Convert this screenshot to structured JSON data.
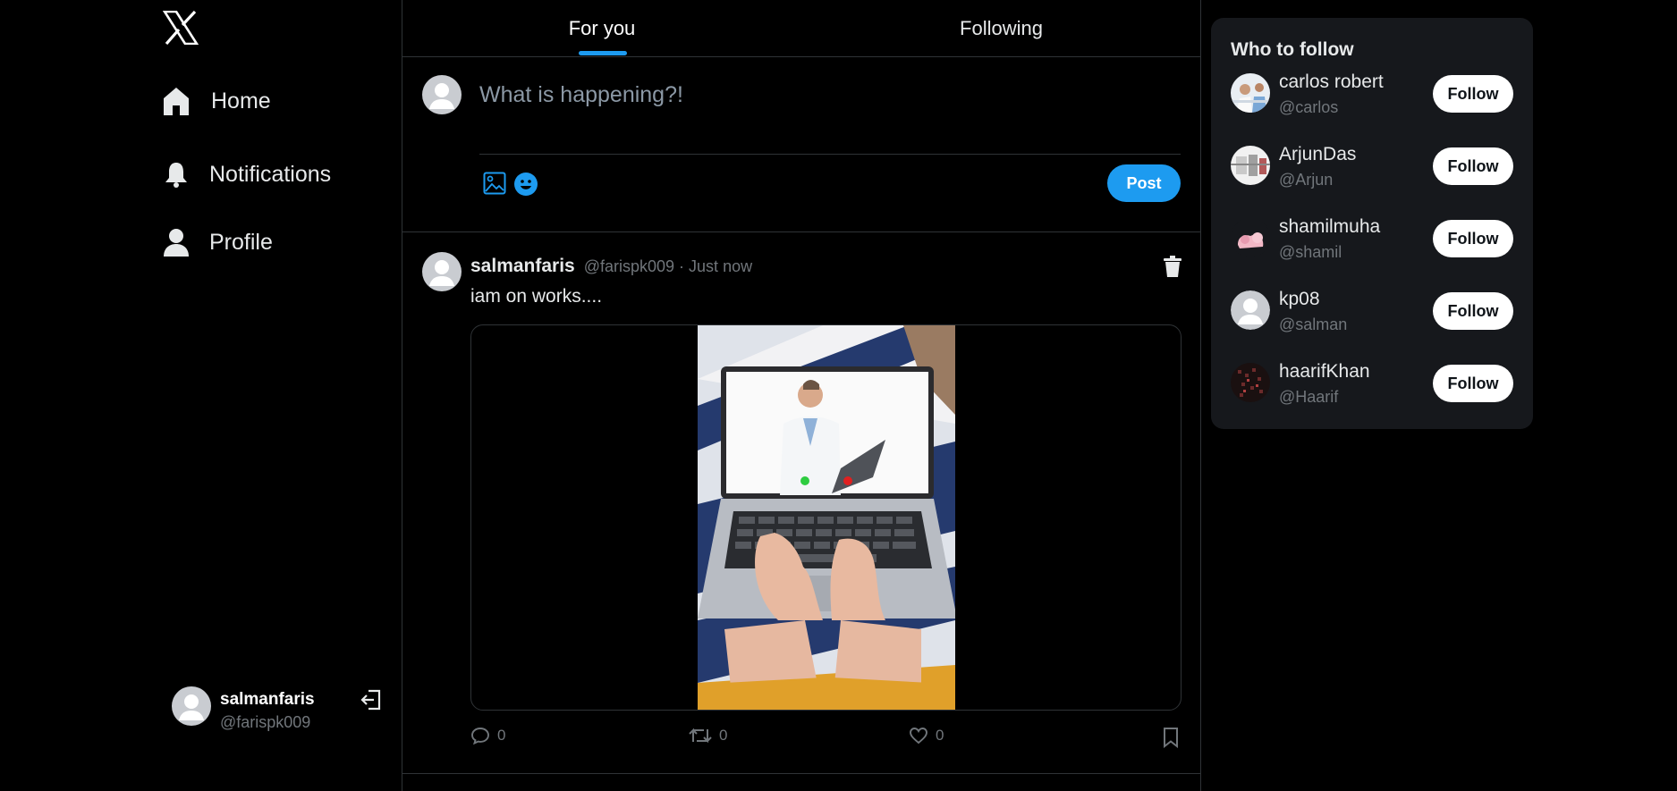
{
  "sidebar": {
    "logo": "x-logo",
    "items": [
      {
        "label": "Home",
        "icon": "home-icon"
      },
      {
        "label": "Notifications",
        "icon": "bell-icon"
      },
      {
        "label": "Profile",
        "icon": "person-icon"
      }
    ],
    "account": {
      "name": "salmanfaris",
      "handle": "@farispk009",
      "logout_icon": "logout-icon"
    }
  },
  "tabs": [
    {
      "label": "For you",
      "active": true
    },
    {
      "label": "Following",
      "active": false
    }
  ],
  "composer": {
    "placeholder": "What is happening?!",
    "post_label": "Post"
  },
  "tweet": {
    "author": "salmanfaris",
    "handle": "@farispk009 · Just now",
    "text": "iam on works....",
    "reply_count": "0",
    "retweet_count": "0",
    "like_count": "0"
  },
  "who_to_follow": {
    "title": "Who to follow",
    "users": [
      {
        "name": "carlos robert",
        "handle": "@carlos",
        "button": "Follow"
      },
      {
        "name": "ArjunDas",
        "handle": "@Arjun",
        "button": "Follow"
      },
      {
        "name": "shamilmuha",
        "handle": "@shamil",
        "button": "Follow"
      },
      {
        "name": "kp08",
        "handle": "@salman",
        "button": "Follow"
      },
      {
        "name": "haarifKhan",
        "handle": "@Haarif",
        "button": "Follow"
      }
    ]
  },
  "colors": {
    "accent": "#1d9bf0",
    "background": "#000000",
    "panel": "#16181c",
    "muted": "#71767b"
  }
}
